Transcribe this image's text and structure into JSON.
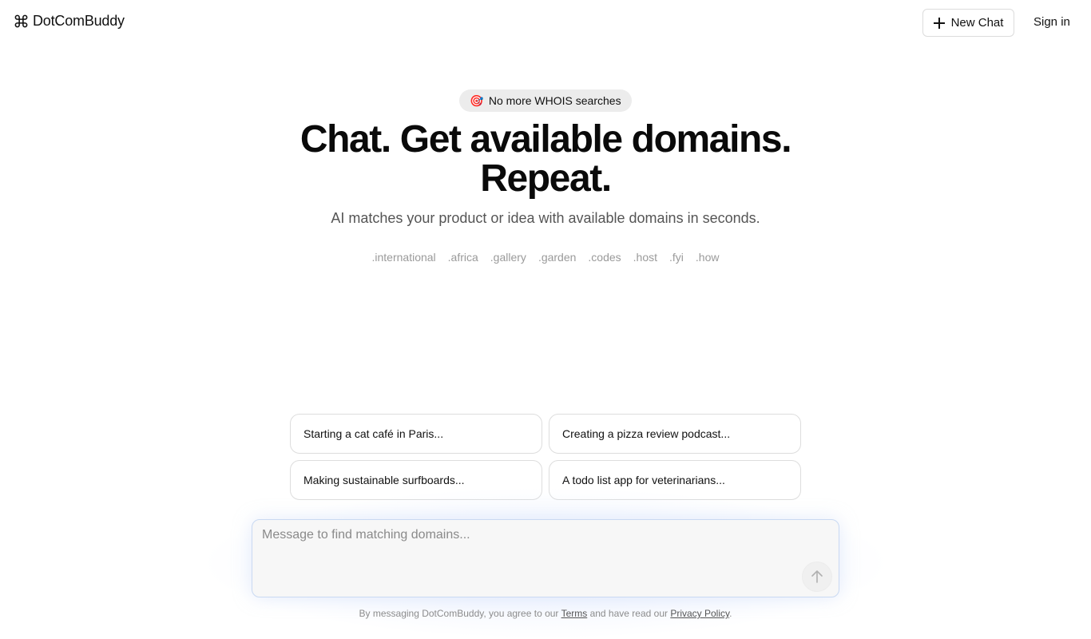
{
  "header": {
    "brand_name": "DotComBuddy",
    "brand_icon": "command-icon",
    "new_chat_label": "New Chat",
    "sign_in_label": "Sign in"
  },
  "hero": {
    "badge_emoji": "🎯",
    "badge_text": "No more WHOIS searches",
    "headline_line1": "Chat. Get available domains.",
    "headline_line2": "Repeat.",
    "subhead": "AI matches your product or idea with available domains in seconds.",
    "tlds": [
      ".international",
      ".africa",
      ".gallery",
      ".garden",
      ".codes",
      ".host",
      ".fyi",
      ".how"
    ]
  },
  "suggestions": [
    "Starting a cat café in Paris...",
    "Creating a pizza review podcast...",
    "Making sustainable surfboards...",
    "A todo list app for veterinarians..."
  ],
  "composer": {
    "placeholder": "Message to find matching domains...",
    "value": "",
    "send_icon": "arrow-up-icon"
  },
  "footer": {
    "prefix": "By messaging DotComBuddy, you agree to our",
    "terms_label": "Terms",
    "middle": "and have read our",
    "privacy_label": "Privacy Policy",
    "suffix": "."
  },
  "colors": {
    "text": "#111111",
    "muted": "#555555",
    "tld": "#9a9a9a",
    "badge_bg": "#ececec",
    "composer_border": "#c9d9f2"
  }
}
